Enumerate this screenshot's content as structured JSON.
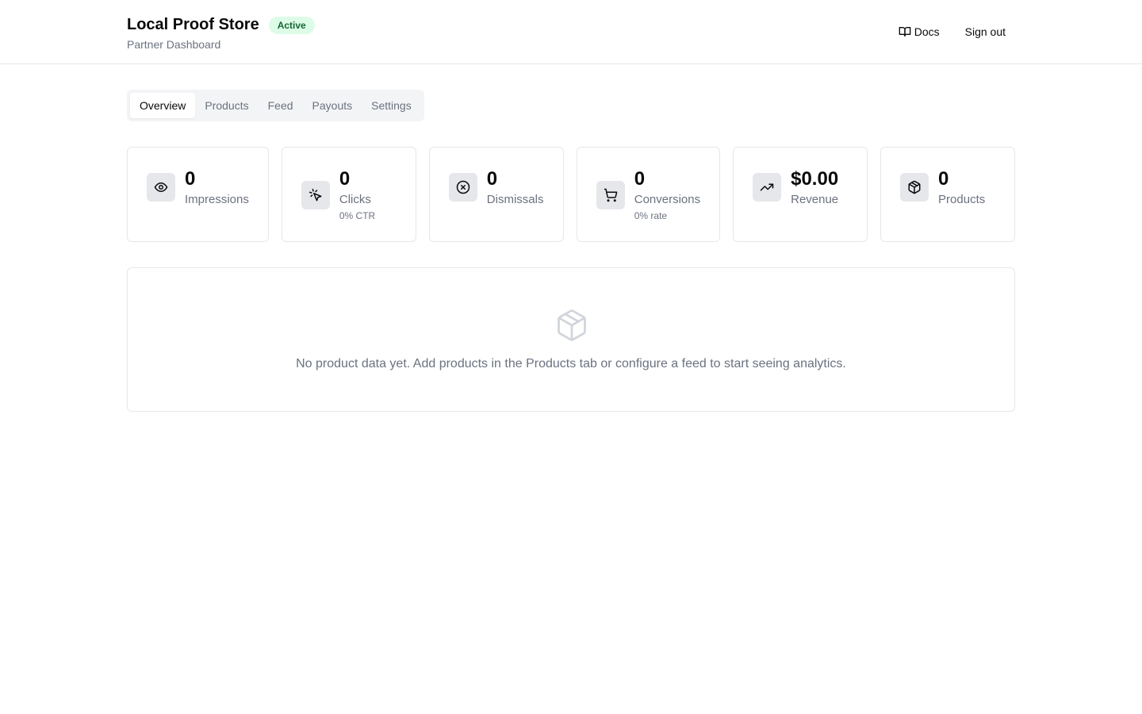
{
  "header": {
    "store_name": "Local Proof Store",
    "status": "Active",
    "subtitle": "Partner Dashboard",
    "docs_label": "Docs",
    "signout_label": "Sign out"
  },
  "tabs": [
    {
      "label": "Overview",
      "active": true
    },
    {
      "label": "Products",
      "active": false
    },
    {
      "label": "Feed",
      "active": false
    },
    {
      "label": "Payouts",
      "active": false
    },
    {
      "label": "Settings",
      "active": false
    }
  ],
  "stats": [
    {
      "icon": "eye-icon",
      "value": "0",
      "label": "Impressions",
      "sub": ""
    },
    {
      "icon": "pointer-click-icon",
      "value": "0",
      "label": "Clicks",
      "sub": "0% CTR"
    },
    {
      "icon": "x-circle-icon",
      "value": "0",
      "label": "Dismissals",
      "sub": ""
    },
    {
      "icon": "shopping-cart-icon",
      "value": "0",
      "label": "Conversions",
      "sub": "0% rate"
    },
    {
      "icon": "trending-up-icon",
      "value": "$0.00",
      "label": "Revenue",
      "sub": ""
    },
    {
      "icon": "package-icon",
      "value": "0",
      "label": "Products",
      "sub": ""
    }
  ],
  "empty_state": {
    "icon": "package-icon",
    "message": "No product data yet. Add products in the Products tab or configure a feed to start seeing analytics."
  },
  "colors": {
    "accent_badge_bg": "#dcfce7",
    "accent_badge_text": "#166534",
    "muted_text": "#6b7280",
    "border": "#e5e7eb"
  }
}
